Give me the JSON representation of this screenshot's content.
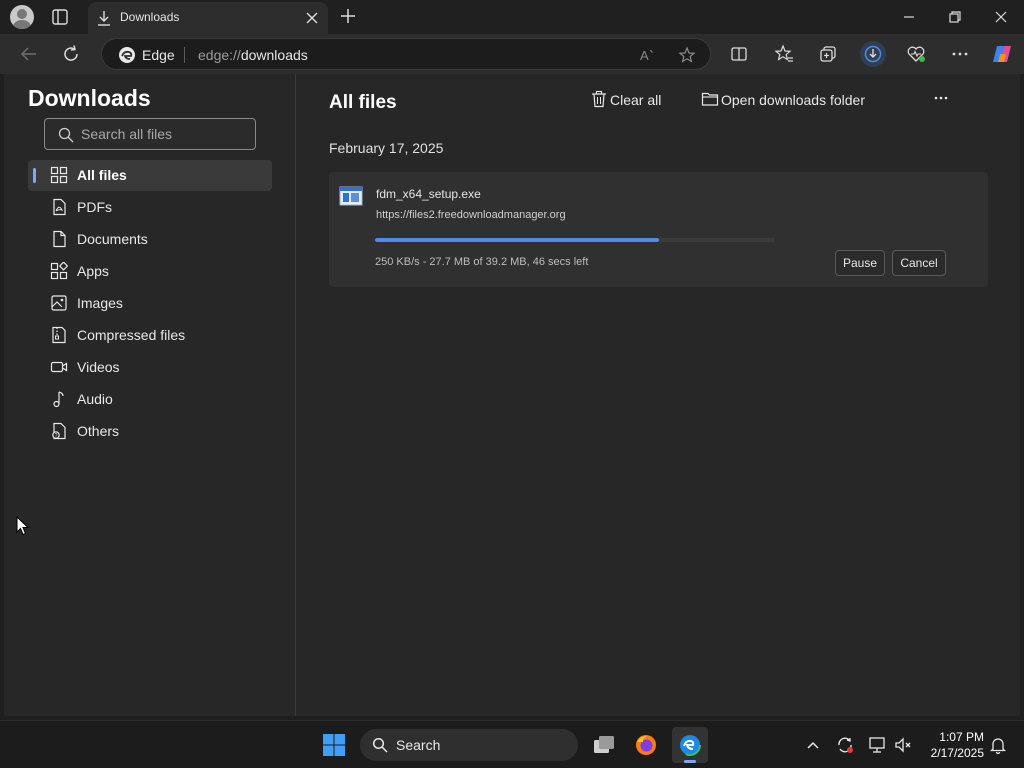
{
  "window": {
    "tab_title": "Downloads"
  },
  "address_bar": {
    "site_label": "Edge",
    "url_scheme": "edge://",
    "url_path": "downloads"
  },
  "sidebar": {
    "title": "Downloads",
    "search_placeholder": "Search all files",
    "items": [
      {
        "label": "All files",
        "icon": "grid-icon",
        "active": true
      },
      {
        "label": "PDFs",
        "icon": "pdf-icon"
      },
      {
        "label": "Documents",
        "icon": "document-icon"
      },
      {
        "label": "Apps",
        "icon": "apps-icon"
      },
      {
        "label": "Images",
        "icon": "image-icon"
      },
      {
        "label": "Compressed files",
        "icon": "archive-icon"
      },
      {
        "label": "Videos",
        "icon": "video-icon"
      },
      {
        "label": "Audio",
        "icon": "music-icon"
      },
      {
        "label": "Others",
        "icon": "other-file-icon"
      }
    ]
  },
  "main": {
    "title": "All files",
    "clear_all_label": "Clear all",
    "open_folder_label": "Open downloads folder",
    "date_group": "February 17, 2025",
    "download": {
      "file_name": "fdm_x64_setup.exe",
      "source_url": "https://files2.freedownloadmanager.org",
      "status": "250 KB/s - 27.7 MB of 39.2 MB, 46 secs left",
      "progress_fraction": 0.71,
      "pause_label": "Pause",
      "cancel_label": "Cancel"
    }
  },
  "taskbar": {
    "search_label": "Search",
    "time": "1:07 PM",
    "date": "2/17/2025"
  },
  "colors": {
    "accent": "#4f8ae6",
    "background": "#272727",
    "sidebar_active": "#3a3a3a"
  }
}
